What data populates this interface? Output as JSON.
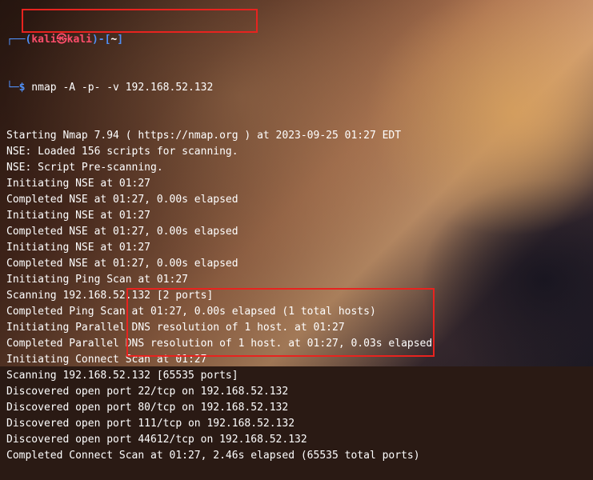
{
  "prompt": {
    "top_prefix": "┌──(",
    "user_host": "kali㉿kali",
    "top_mid": ")-[",
    "cwd": "~",
    "top_suffix": "]",
    "bottom_prefix": "└─",
    "symbol": "$",
    "command": " nmap -A -p- -v 192.168.52.132"
  },
  "output_lines": [
    "Starting Nmap 7.94 ( https://nmap.org ) at 2023-09-25 01:27 EDT",
    "NSE: Loaded 156 scripts for scanning.",
    "NSE: Script Pre-scanning.",
    "Initiating NSE at 01:27",
    "Completed NSE at 01:27, 0.00s elapsed",
    "Initiating NSE at 01:27",
    "Completed NSE at 01:27, 0.00s elapsed",
    "Initiating NSE at 01:27",
    "Completed NSE at 01:27, 0.00s elapsed",
    "Initiating Ping Scan at 01:27",
    "Scanning 192.168.52.132 [2 ports]",
    "Completed Ping Scan at 01:27, 0.00s elapsed (1 total hosts)",
    "Initiating Parallel DNS resolution of 1 host. at 01:27",
    "Completed Parallel DNS resolution of 1 host. at 01:27, 0.03s elapsed",
    "Initiating Connect Scan at 01:27",
    "Scanning 192.168.52.132 [65535 ports]",
    "Discovered open port 22/tcp on 192.168.52.132",
    "Discovered open port 80/tcp on 192.168.52.132",
    "Discovered open port 111/tcp on 192.168.52.132",
    "Discovered open port 44612/tcp on 192.168.52.132",
    "Completed Connect Scan at 01:27, 2.46s elapsed (65535 total ports)"
  ],
  "colors": {
    "prompt": "#4f8ff7",
    "user_host": "#ff4d6b",
    "highlight_box": "#e8231f",
    "text": "#ffffff"
  }
}
